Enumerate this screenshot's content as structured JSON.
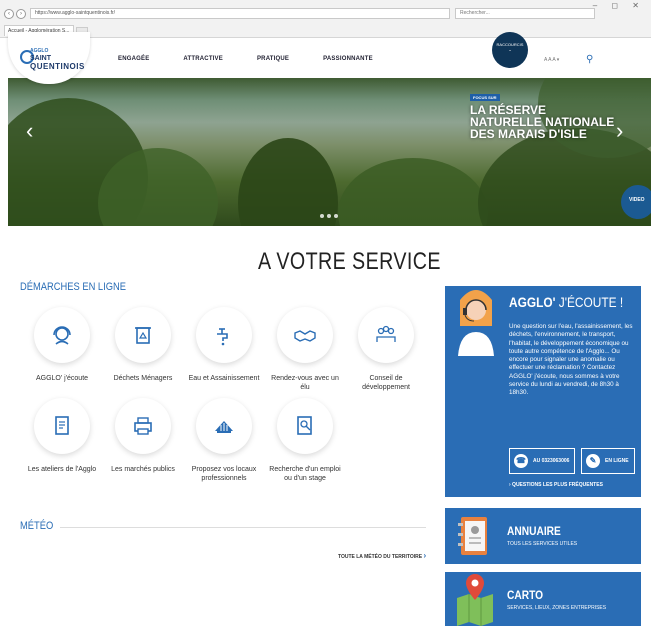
{
  "browser": {
    "window_controls": "– ◻ ✕",
    "url": "https://www.agglo-saintquentinois.fr/",
    "search_placeholder": "Rechercher...",
    "tab_title": "Accueil - Agglomération S..."
  },
  "header": {
    "logo_line1": "AGGLO",
    "logo_line2": "SAINT",
    "logo_line3": "QUENTINOIS",
    "nav": [
      "ENGAGÉE",
      "ATTRACTIVE",
      "PRATIQUE",
      "PASSIONNANTE"
    ],
    "shortcut_label": "RACCOURCIS",
    "lang": "A A A ▾"
  },
  "hero": {
    "badge": "FOCUS SUR",
    "title": "La réserve naturelle nationale des marais d'Isle",
    "prev": "‹",
    "next": "›",
    "side_video": "VIDEO"
  },
  "main": {
    "section_title": "A VOTRE SERVICE",
    "demarches_title": "DÉMARCHES EN LIGNE",
    "services": [
      {
        "label": "AGGLO' j'écoute",
        "icon": "headset-icon"
      },
      {
        "label": "Déchets Ménagers",
        "icon": "recycle-bin-icon"
      },
      {
        "label": "Eau et Assainissement",
        "icon": "water-tap-icon"
      },
      {
        "label": "Rendez-vous avec un élu",
        "icon": "handshake-icon"
      },
      {
        "label": "Conseil de développement",
        "icon": "people-group-icon"
      },
      {
        "label": "Les ateliers de l'Agglo",
        "icon": "document-icon"
      },
      {
        "label": "Les marchés publics",
        "icon": "printer-icon"
      },
      {
        "label": "Proposez vos locaux professionnels",
        "icon": "building-icon"
      },
      {
        "label": "Recherche d'un emploi ou d'un stage",
        "icon": "job-search-icon"
      }
    ],
    "meteo_title": "MÉTÉO",
    "meteo_link": "TOUTE LA MÉTÉO DU TERRITOIRE",
    "meteo_arrow": "›"
  },
  "sidebar": {
    "ecoute_title_bold": "AGGLO'",
    "ecoute_title_light": " J'ÉCOUTE !",
    "ecoute_text": "Une question sur l'eau, l'assainissement, les déchets, l'environnement, le transport, l'habitat, le développement économique ou toute autre compétence de l'Agglo... Ou encore pour signaler une anomalie ou effectuer une réclamation ? Contactez AGGLO' j'écoute, nous sommes à votre service du lundi au vendredi, de 8h30 à 18h30.",
    "phone_label": "AU 0323063006",
    "phone_icon": "☎",
    "online_label": "EN LIGNE",
    "online_icon": "✎",
    "faq_link": "› QUESTIONS LES PLUS FRÉQUENTES",
    "annuaire_title": "ANNUAIRE",
    "annuaire_sub": "TOUS LES SERVICES UTILES",
    "carto_title": "CARTO",
    "carto_sub": "SERVICES, LIEUX, ZONES ENTREPRISES"
  },
  "colors": {
    "brand_blue": "#2a6db5",
    "dark_navy": "#0f3557"
  }
}
